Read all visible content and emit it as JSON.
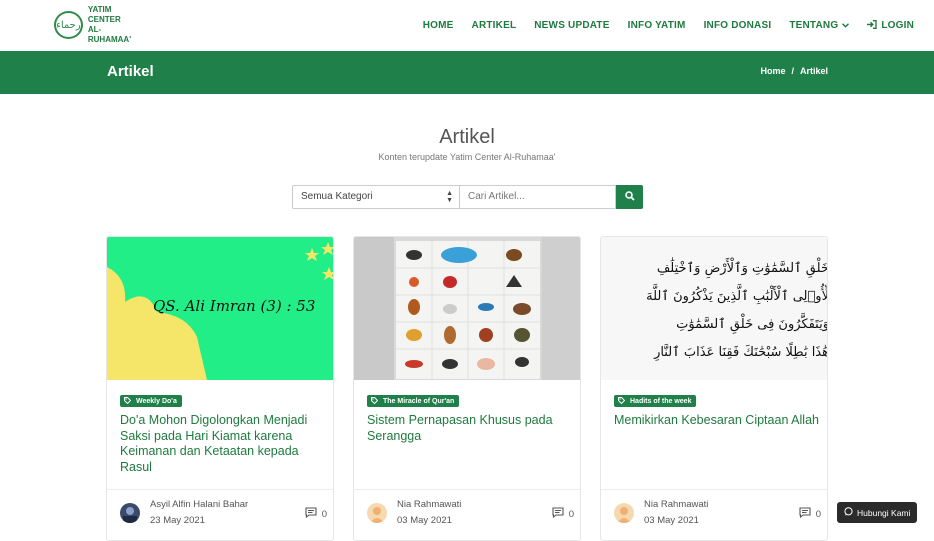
{
  "brand": {
    "line1": "YATIM CENTER",
    "line2": "AL-RUHAMAA'",
    "mark": "رحماء"
  },
  "nav": {
    "items": [
      "HOME",
      "ARTIKEL",
      "NEWS UPDATE",
      "INFO YATIM",
      "INFO DONASI",
      "TENTANG"
    ],
    "login": "LOGIN"
  },
  "banner": {
    "title": "Artikel",
    "breadcrumb_home": "Home",
    "breadcrumb_sep": "/",
    "breadcrumb_current": "Artikel"
  },
  "section": {
    "title": "Artikel",
    "subtitle": "Konten terupdate Yatim Center Al-Ruhamaa'"
  },
  "filter": {
    "category_value": "Semua Kategori",
    "search_placeholder": "Cari Artikel..."
  },
  "articles": [
    {
      "category": "Weekly Do'a",
      "title": "Do'a Mohon Digolongkan Menjadi Saksi pada Hari Kiamat karena Keimanan dan Ketaatan kepada Rasul",
      "image_caption": "QS. Ali Imran (3) : 53",
      "author": "Asyil Alfin Halani Bahar",
      "date": "23 May 2021",
      "comments": "0"
    },
    {
      "category": "The Miracle of Qur'an",
      "title": "Sistem Pernapasan Khusus pada Serangga",
      "author": "Nia Rahmawati",
      "date": "03 May 2021",
      "comments": "0"
    },
    {
      "category": "Hadits of the week",
      "title": "Memikirkan Kebesaran Ciptaan Allah",
      "arabic_lines": [
        "خَلْقِ ٱلسَّمَٰوَٰتِ وَٱلْأَرْضِ وَٱخْتِلَٰفِ",
        "لِّأُو۟لِى ٱلْأَلْبَٰبِ ٱلَّذِينَ يَذْكُرُونَ ٱللَّهَ",
        "وَيَتَفَكَّرُونَ فِى خَلْقِ ٱلسَّمَٰوَٰتِ",
        "هَٰذَا بَٰطِلًا سُبْحَٰنَكَ فَقِنَا عَذَابَ ٱلنَّارِ"
      ],
      "author": "Nia Rahmawati",
      "date": "03 May 2021",
      "comments": "0"
    }
  ],
  "contact_button": "Hubungi Kami",
  "colors": {
    "primary": "#20804a",
    "link": "#1f7a3e",
    "card1_bg": "#22ee88",
    "card1_shape": "#f5e66a"
  }
}
